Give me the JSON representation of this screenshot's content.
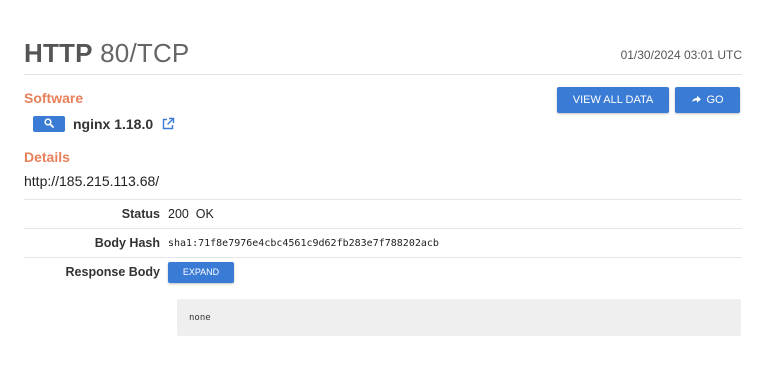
{
  "header": {
    "protocol": "HTTP",
    "port_label": "80/TCP",
    "timestamp": "01/30/2024 03:01 UTC"
  },
  "software": {
    "section_title": "Software",
    "name": "nginx 1.18.0",
    "search_icon": "search-icon",
    "link_icon": "external-link-icon"
  },
  "actions": {
    "view_all_label": "VIEW ALL DATA",
    "go_label": "GO"
  },
  "details": {
    "section_title": "Details",
    "url": "http://185.215.113.68/",
    "rows": [
      {
        "label": "Status",
        "value": "200  OK"
      },
      {
        "label": "Body Hash",
        "value": "sha1:71f8e7976e4cbc4561c9d62fb283e7f788202acb"
      },
      {
        "label": "Response Body",
        "button": "EXPAND"
      }
    ],
    "response_body": "none"
  },
  "colors": {
    "accent": "#3a7bd5",
    "section_title": "#e8805a"
  }
}
